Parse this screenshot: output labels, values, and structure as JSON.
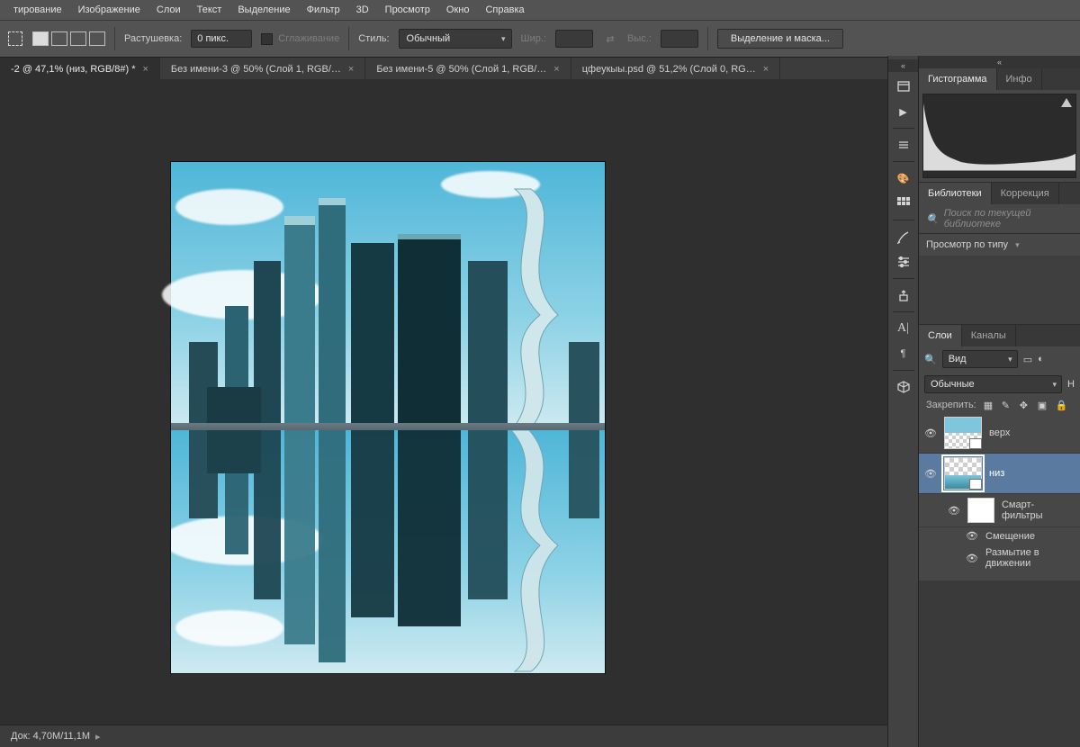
{
  "menu": [
    "тирование",
    "Изображение",
    "Слои",
    "Текст",
    "Выделение",
    "Фильтр",
    "3D",
    "Просмотр",
    "Окно",
    "Справка"
  ],
  "options": {
    "feather_label": "Растушевка:",
    "feather_value": "0 пикс.",
    "antialias": "Сглаживание",
    "style_label": "Стиль:",
    "style_value": "Обычный",
    "width_label": "Шир.:",
    "height_label": "Выс.:",
    "select_mask": "Выделение и маска..."
  },
  "tabs": [
    {
      "label": "-2 @ 47,1% (низ, RGB/8#) *",
      "active": true
    },
    {
      "label": "Без имени-3 @ 50% (Слой 1, RGB/…",
      "active": false
    },
    {
      "label": "Без имени-5 @ 50% (Слой 1, RGB/…",
      "active": false
    },
    {
      "label": "цфеукыы.psd @ 51,2% (Слой 0, RG…",
      "active": false
    }
  ],
  "status": {
    "doc": "Док: 4,70M/11,1M"
  },
  "panel_histogram": {
    "tab1": "Гистограмма",
    "tab2": "Инфо"
  },
  "panel_lib": {
    "tab1": "Библиотеки",
    "tab2": "Коррекция",
    "search_ph": "Поиск по текущей библиотеке",
    "view": "Просмотр по типу"
  },
  "panel_layers": {
    "tab1": "Слои",
    "tab2": "Каналы",
    "search_icon": "🔍",
    "kind": "Вид",
    "mode": "Обычные",
    "opacity_lbl": "Н",
    "lock_label": "Закрепить:",
    "layers": [
      {
        "name": "верх"
      },
      {
        "name": "низ",
        "selected": true
      }
    ],
    "smart": "Смарт-фильтры",
    "fx": [
      "Смещение",
      "Размытие в движении"
    ]
  }
}
